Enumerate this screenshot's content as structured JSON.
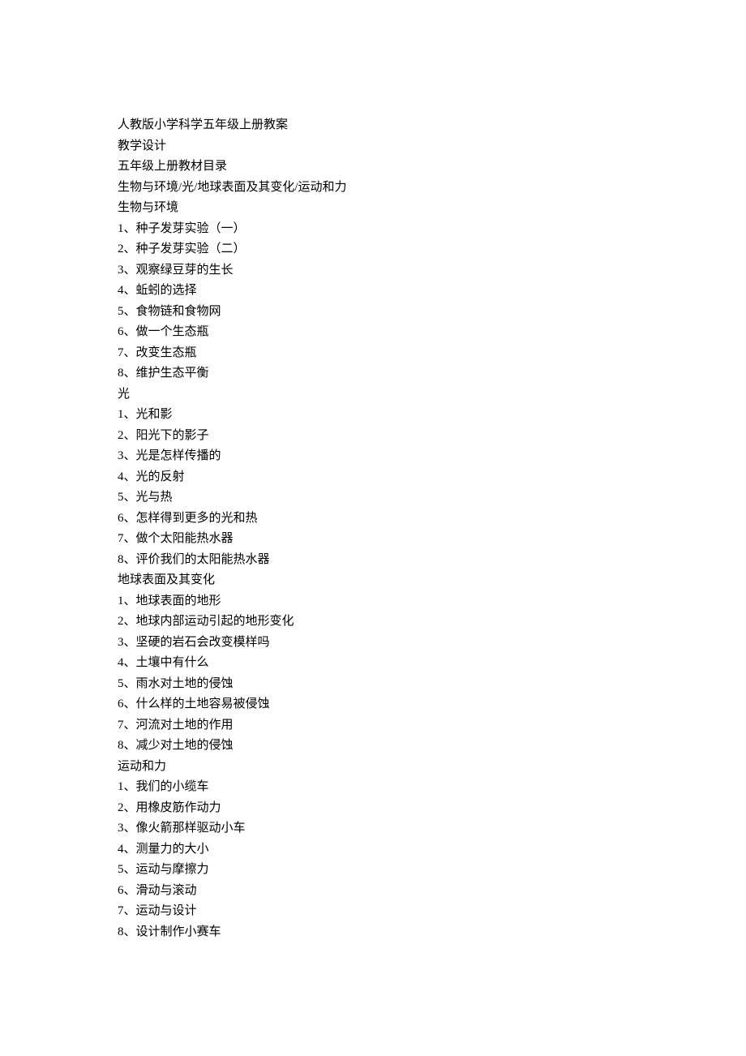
{
  "header": {
    "title": "人教版小学科学五年级上册教案",
    "subtitle": "教学设计",
    "toc_title": "五年级上册教材目录",
    "units_summary": "生物与环境/光/地球表面及其变化/运动和力"
  },
  "units": [
    {
      "title": "生物与环境",
      "items": [
        "1、种子发芽实验（一）",
        "2、种子发芽实验（二）",
        "3、观察绿豆芽的生长",
        "4、蚯蚓的选择",
        "5、食物链和食物网",
        "6、做一个生态瓶",
        "7、改变生态瓶",
        "8、维护生态平衡"
      ]
    },
    {
      "title": "光",
      "items": [
        "1、光和影",
        "2、阳光下的影子",
        "3、光是怎样传播的",
        "4、光的反射",
        "5、光与热",
        "6、怎样得到更多的光和热",
        "7、做个太阳能热水器",
        "8、评价我们的太阳能热水器"
      ]
    },
    {
      "title": "地球表面及其变化",
      "items": [
        "1、地球表面的地形",
        "2、地球内部运动引起的地形变化",
        "3、坚硬的岩石会改变模样吗",
        "4、土壤中有什么",
        "5、雨水对土地的侵蚀",
        "6、什么样的土地容易被侵蚀",
        "7、河流对土地的作用",
        "8、减少对土地的侵蚀"
      ]
    },
    {
      "title": "运动和力",
      "items": [
        "1、我们的小缆车",
        "2、用橡皮筋作动力",
        "3、像火箭那样驱动小车",
        "4、测量力的大小",
        "5、运动与摩擦力",
        "6、滑动与滚动",
        "7、运动与设计",
        "8、设计制作小赛车"
      ]
    }
  ]
}
